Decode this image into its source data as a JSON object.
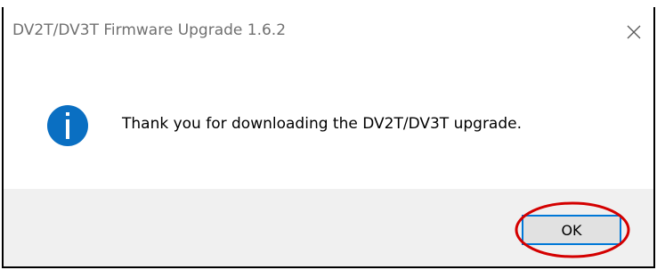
{
  "window": {
    "title": "DV2T/DV3T Firmware Upgrade 1.6.2"
  },
  "icons": {
    "close": "close-icon",
    "info": "info-icon"
  },
  "message": {
    "text": "Thank you for downloading the DV2T/DV3T upgrade."
  },
  "buttons": {
    "ok_label": "OK"
  },
  "colors": {
    "info_icon": "#0a6fc2",
    "annotation": "#d40000",
    "focus_border": "#0078d7"
  }
}
